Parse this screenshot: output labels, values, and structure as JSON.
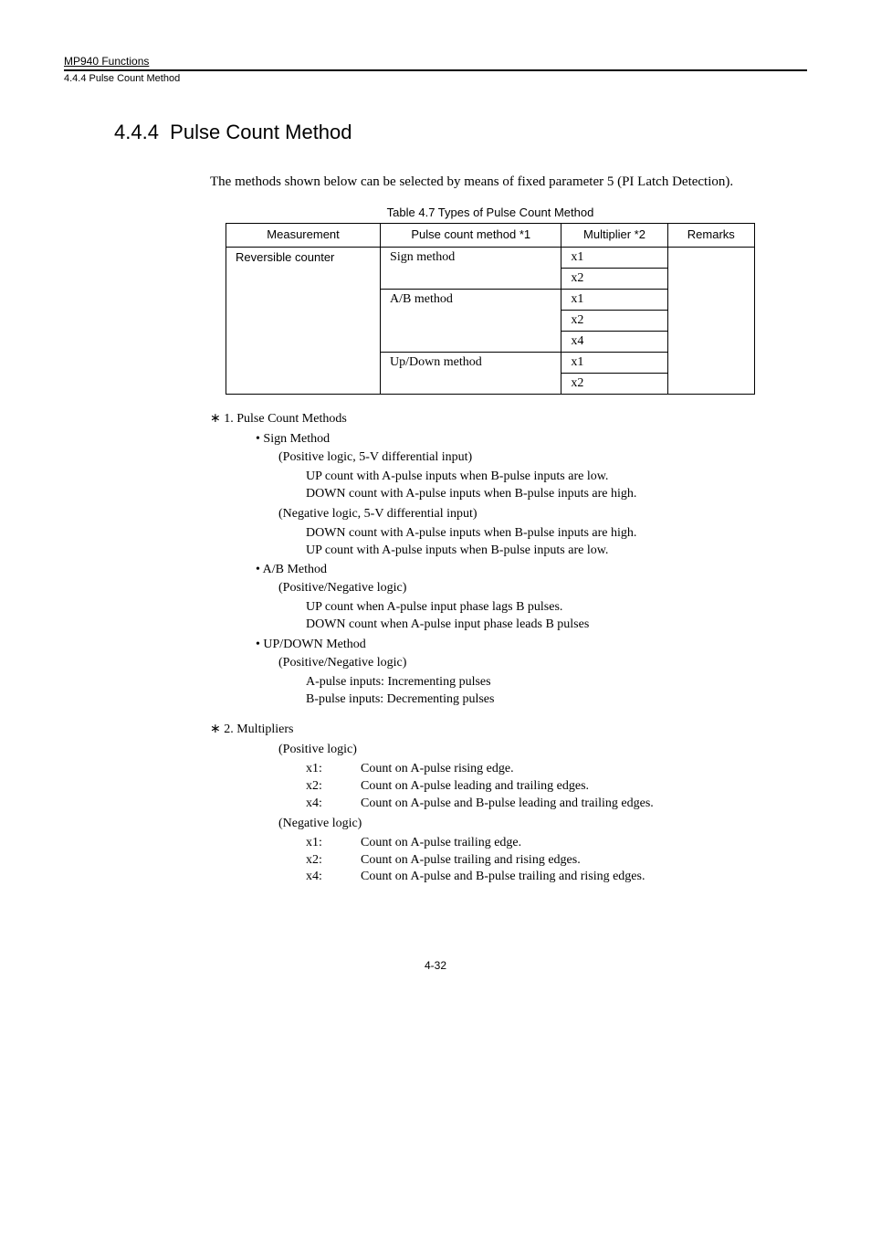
{
  "header": {
    "chapter": "MP940 Functions",
    "subsection": "4.4.4  Pulse Count Method"
  },
  "section": {
    "number": "4.4.4",
    "title": "Pulse Count Method"
  },
  "intro": "The methods shown below can be selected by means of fixed parameter 5 (PI Latch Detection).",
  "table": {
    "caption": "Table 4.7  Types of Pulse Count Method",
    "headers": {
      "measurement": "Measurement",
      "pulse_count": "Pulse count method *1",
      "multiplier": "Multiplier *2",
      "remarks": "Remarks"
    },
    "measurement": "Reversible counter",
    "methods": [
      {
        "name": "Sign method",
        "multipliers": [
          "x1",
          "x2"
        ]
      },
      {
        "name": "A/B method",
        "multipliers": [
          "x1",
          "x2",
          "x4"
        ]
      },
      {
        "name": "Up/Down method",
        "multipliers": [
          "x1",
          "x2"
        ]
      }
    ]
  },
  "notes": {
    "n1": {
      "label": "∗ 1.  Pulse Count Methods",
      "sign": {
        "title": "• Sign Method",
        "pos": {
          "title": "(Positive logic, 5-V differential input)",
          "l1": "UP count with A-pulse inputs when B-pulse inputs are low.",
          "l2": "DOWN count with A-pulse inputs when B-pulse inputs are high."
        },
        "neg": {
          "title": "(Negative logic, 5-V differential input)",
          "l1": "DOWN count with A-pulse inputs when B-pulse inputs are high.",
          "l2": "UP count with A-pulse inputs when B-pulse inputs are low."
        }
      },
      "ab": {
        "title": "• A/B Method",
        "posneg": {
          "title": "(Positive/Negative logic)",
          "l1": "UP count when A-pulse input phase lags B pulses.",
          "l2": "DOWN count when A-pulse input phase leads B pulses"
        }
      },
      "updown": {
        "title": "• UP/DOWN Method",
        "posneg": {
          "title": "(Positive/Negative logic)",
          "l1": "A-pulse inputs: Incrementing pulses",
          "l2": "B-pulse inputs: Decrementing pulses"
        }
      }
    },
    "n2": {
      "label": "∗ 2.  Multipliers",
      "pos": {
        "title": "(Positive logic)",
        "x1": {
          "k": "x1:",
          "v": "Count on A-pulse rising edge."
        },
        "x2": {
          "k": "x2:",
          "v": "Count on A-pulse leading and trailing edges."
        },
        "x4": {
          "k": "x4:",
          "v": "Count on A-pulse and B-pulse leading and trailing edges."
        }
      },
      "neg": {
        "title": "(Negative logic)",
        "x1": {
          "k": "x1:",
          "v": "Count on A-pulse trailing edge."
        },
        "x2": {
          "k": "x2:",
          "v": "Count on A-pulse trailing and rising edges."
        },
        "x4": {
          "k": "x4:",
          "v": "Count on A-pulse and B-pulse trailing and rising edges."
        }
      }
    }
  },
  "page_num": "4-32"
}
